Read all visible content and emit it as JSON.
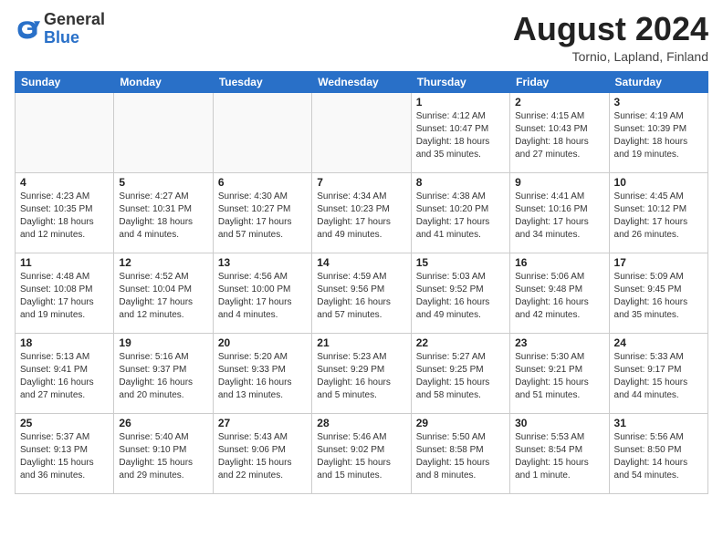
{
  "header": {
    "logo_general": "General",
    "logo_blue": "Blue",
    "title": "August 2024",
    "subtitle": "Tornio, Lapland, Finland"
  },
  "weekdays": [
    "Sunday",
    "Monday",
    "Tuesday",
    "Wednesday",
    "Thursday",
    "Friday",
    "Saturday"
  ],
  "weeks": [
    [
      {
        "day": "",
        "info": ""
      },
      {
        "day": "",
        "info": ""
      },
      {
        "day": "",
        "info": ""
      },
      {
        "day": "",
        "info": ""
      },
      {
        "day": "1",
        "info": "Sunrise: 4:12 AM\nSunset: 10:47 PM\nDaylight: 18 hours\nand 35 minutes."
      },
      {
        "day": "2",
        "info": "Sunrise: 4:15 AM\nSunset: 10:43 PM\nDaylight: 18 hours\nand 27 minutes."
      },
      {
        "day": "3",
        "info": "Sunrise: 4:19 AM\nSunset: 10:39 PM\nDaylight: 18 hours\nand 19 minutes."
      }
    ],
    [
      {
        "day": "4",
        "info": "Sunrise: 4:23 AM\nSunset: 10:35 PM\nDaylight: 18 hours\nand 12 minutes."
      },
      {
        "day": "5",
        "info": "Sunrise: 4:27 AM\nSunset: 10:31 PM\nDaylight: 18 hours\nand 4 minutes."
      },
      {
        "day": "6",
        "info": "Sunrise: 4:30 AM\nSunset: 10:27 PM\nDaylight: 17 hours\nand 57 minutes."
      },
      {
        "day": "7",
        "info": "Sunrise: 4:34 AM\nSunset: 10:23 PM\nDaylight: 17 hours\nand 49 minutes."
      },
      {
        "day": "8",
        "info": "Sunrise: 4:38 AM\nSunset: 10:20 PM\nDaylight: 17 hours\nand 41 minutes."
      },
      {
        "day": "9",
        "info": "Sunrise: 4:41 AM\nSunset: 10:16 PM\nDaylight: 17 hours\nand 34 minutes."
      },
      {
        "day": "10",
        "info": "Sunrise: 4:45 AM\nSunset: 10:12 PM\nDaylight: 17 hours\nand 26 minutes."
      }
    ],
    [
      {
        "day": "11",
        "info": "Sunrise: 4:48 AM\nSunset: 10:08 PM\nDaylight: 17 hours\nand 19 minutes."
      },
      {
        "day": "12",
        "info": "Sunrise: 4:52 AM\nSunset: 10:04 PM\nDaylight: 17 hours\nand 12 minutes."
      },
      {
        "day": "13",
        "info": "Sunrise: 4:56 AM\nSunset: 10:00 PM\nDaylight: 17 hours\nand 4 minutes."
      },
      {
        "day": "14",
        "info": "Sunrise: 4:59 AM\nSunset: 9:56 PM\nDaylight: 16 hours\nand 57 minutes."
      },
      {
        "day": "15",
        "info": "Sunrise: 5:03 AM\nSunset: 9:52 PM\nDaylight: 16 hours\nand 49 minutes."
      },
      {
        "day": "16",
        "info": "Sunrise: 5:06 AM\nSunset: 9:48 PM\nDaylight: 16 hours\nand 42 minutes."
      },
      {
        "day": "17",
        "info": "Sunrise: 5:09 AM\nSunset: 9:45 PM\nDaylight: 16 hours\nand 35 minutes."
      }
    ],
    [
      {
        "day": "18",
        "info": "Sunrise: 5:13 AM\nSunset: 9:41 PM\nDaylight: 16 hours\nand 27 minutes."
      },
      {
        "day": "19",
        "info": "Sunrise: 5:16 AM\nSunset: 9:37 PM\nDaylight: 16 hours\nand 20 minutes."
      },
      {
        "day": "20",
        "info": "Sunrise: 5:20 AM\nSunset: 9:33 PM\nDaylight: 16 hours\nand 13 minutes."
      },
      {
        "day": "21",
        "info": "Sunrise: 5:23 AM\nSunset: 9:29 PM\nDaylight: 16 hours\nand 5 minutes."
      },
      {
        "day": "22",
        "info": "Sunrise: 5:27 AM\nSunset: 9:25 PM\nDaylight: 15 hours\nand 58 minutes."
      },
      {
        "day": "23",
        "info": "Sunrise: 5:30 AM\nSunset: 9:21 PM\nDaylight: 15 hours\nand 51 minutes."
      },
      {
        "day": "24",
        "info": "Sunrise: 5:33 AM\nSunset: 9:17 PM\nDaylight: 15 hours\nand 44 minutes."
      }
    ],
    [
      {
        "day": "25",
        "info": "Sunrise: 5:37 AM\nSunset: 9:13 PM\nDaylight: 15 hours\nand 36 minutes."
      },
      {
        "day": "26",
        "info": "Sunrise: 5:40 AM\nSunset: 9:10 PM\nDaylight: 15 hours\nand 29 minutes."
      },
      {
        "day": "27",
        "info": "Sunrise: 5:43 AM\nSunset: 9:06 PM\nDaylight: 15 hours\nand 22 minutes."
      },
      {
        "day": "28",
        "info": "Sunrise: 5:46 AM\nSunset: 9:02 PM\nDaylight: 15 hours\nand 15 minutes."
      },
      {
        "day": "29",
        "info": "Sunrise: 5:50 AM\nSunset: 8:58 PM\nDaylight: 15 hours\nand 8 minutes."
      },
      {
        "day": "30",
        "info": "Sunrise: 5:53 AM\nSunset: 8:54 PM\nDaylight: 15 hours\nand 1 minute."
      },
      {
        "day": "31",
        "info": "Sunrise: 5:56 AM\nSunset: 8:50 PM\nDaylight: 14 hours\nand 54 minutes."
      }
    ]
  ]
}
